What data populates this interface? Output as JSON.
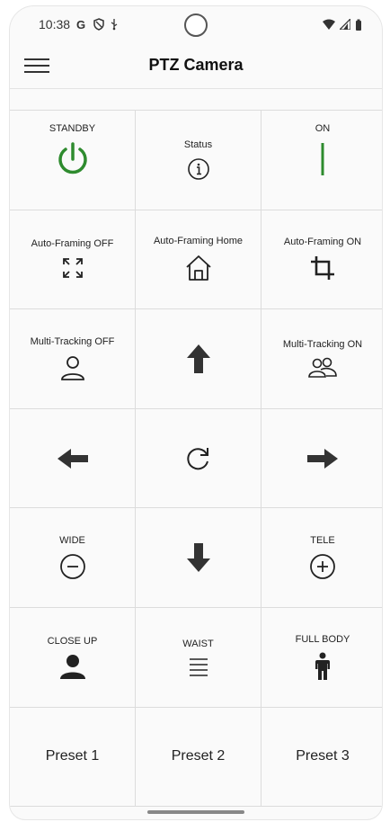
{
  "status_bar": {
    "time": "10:38"
  },
  "app_bar": {
    "title": "PTZ Camera"
  },
  "grid": {
    "standby_label": "STANDBY",
    "status_label": "Status",
    "on_label": "ON",
    "af_off_label": "Auto-Framing OFF",
    "af_home_label": "Auto-Framing Home",
    "af_on_label": "Auto-Framing ON",
    "mt_off_label": "Multi-Tracking OFF",
    "mt_on_label": "Multi-Tracking ON",
    "wide_label": "WIDE",
    "tele_label": "TELE",
    "close_up_label": "CLOSE UP",
    "waist_label": "WAIST",
    "full_body_label": "FULL BODY",
    "preset1_label": "Preset 1",
    "preset2_label": "Preset 2",
    "preset3_label": "Preset 3"
  },
  "colors": {
    "accent_green": "#2e8b2e",
    "icon": "#222222"
  },
  "icons": [
    "menu-icon",
    "power-icon",
    "info-icon",
    "on-bar-icon",
    "expand-icon",
    "home-icon",
    "crop-icon",
    "person-outline-icon",
    "arrow-up-icon",
    "group-icon",
    "arrow-left-icon",
    "refresh-icon",
    "arrow-right-icon",
    "zoom-out-icon",
    "arrow-down-icon",
    "zoom-in-icon",
    "person-bust-icon",
    "lines-icon",
    "person-full-icon"
  ]
}
